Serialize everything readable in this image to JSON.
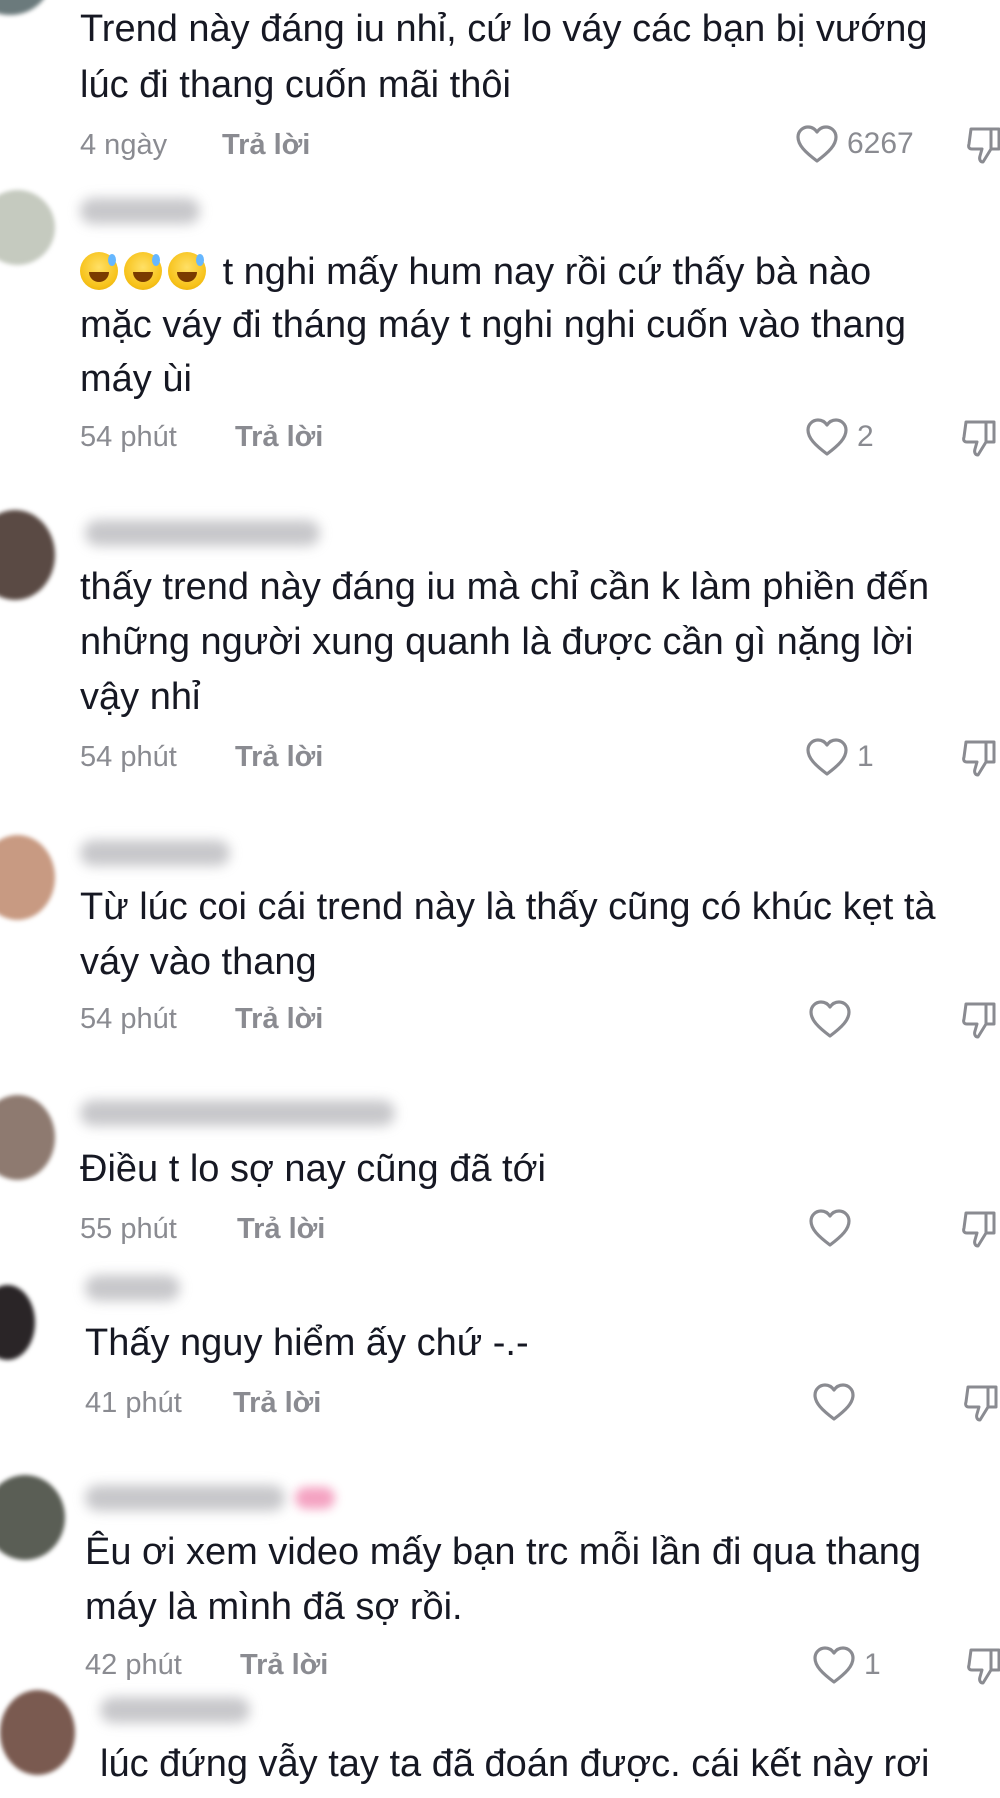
{
  "comments": [
    {
      "lines": [
        "Trend này đáng iu nhỉ, cứ lo váy các bạn bị vướng",
        "lúc đi thang cuốn mãi thôi"
      ],
      "time": "4 ngày",
      "reply": "Trả lời",
      "likes": "6267"
    },
    {
      "lines": [
        "t nghi mấy hum nay rồi cứ thấy bà nào",
        "mặc váy đi tháng máy t nghi nghi cuốn vào thang",
        "máy ùi"
      ],
      "emoji": [
        "grinning-sweat-emoji",
        "grinning-sweat-emoji",
        "grinning-sweat-emoji"
      ],
      "time": "54 phút",
      "reply": "Trả lời",
      "likes": "2"
    },
    {
      "lines": [
        "thấy trend này đáng iu mà chỉ cần k làm phiền đến",
        "những người xung quanh là được cần gì nặng lời",
        "vậy nhỉ"
      ],
      "time": "54 phút",
      "reply": "Trả lời",
      "likes": "1"
    },
    {
      "lines": [
        "Từ lúc coi cái trend này là thấy cũng có khúc kẹt tà",
        "váy vào thang"
      ],
      "time": "54 phút",
      "reply": "Trả lời",
      "likes": ""
    },
    {
      "lines": [
        "Điều t lo sợ nay cũng đã tới"
      ],
      "time": "55 phút",
      "reply": "Trả lời",
      "likes": ""
    },
    {
      "lines": [
        "Thấy nguy hiểm ấy chứ -.-"
      ],
      "time": "41 phút",
      "reply": "Trả lời",
      "likes": ""
    },
    {
      "lines": [
        "Êu ơi xem video mấy bạn trc mỗi lần đi qua thang",
        "máy là mình đã sợ rồi."
      ],
      "time": "42 phút",
      "reply": "Trả lời",
      "likes": "1"
    },
    {
      "lines": [
        "lúc đứng vẫy tay ta đã đoán được. cái kết này rơi"
      ]
    }
  ],
  "colors": {
    "text": "#161823",
    "meta": "#8a8b91",
    "icon": "#8a8b91"
  },
  "icons": {
    "like": "heart-outline-icon",
    "dislike": "thumbs-down-outline-icon",
    "emoji": "grinning-face-with-sweat-emoji"
  }
}
